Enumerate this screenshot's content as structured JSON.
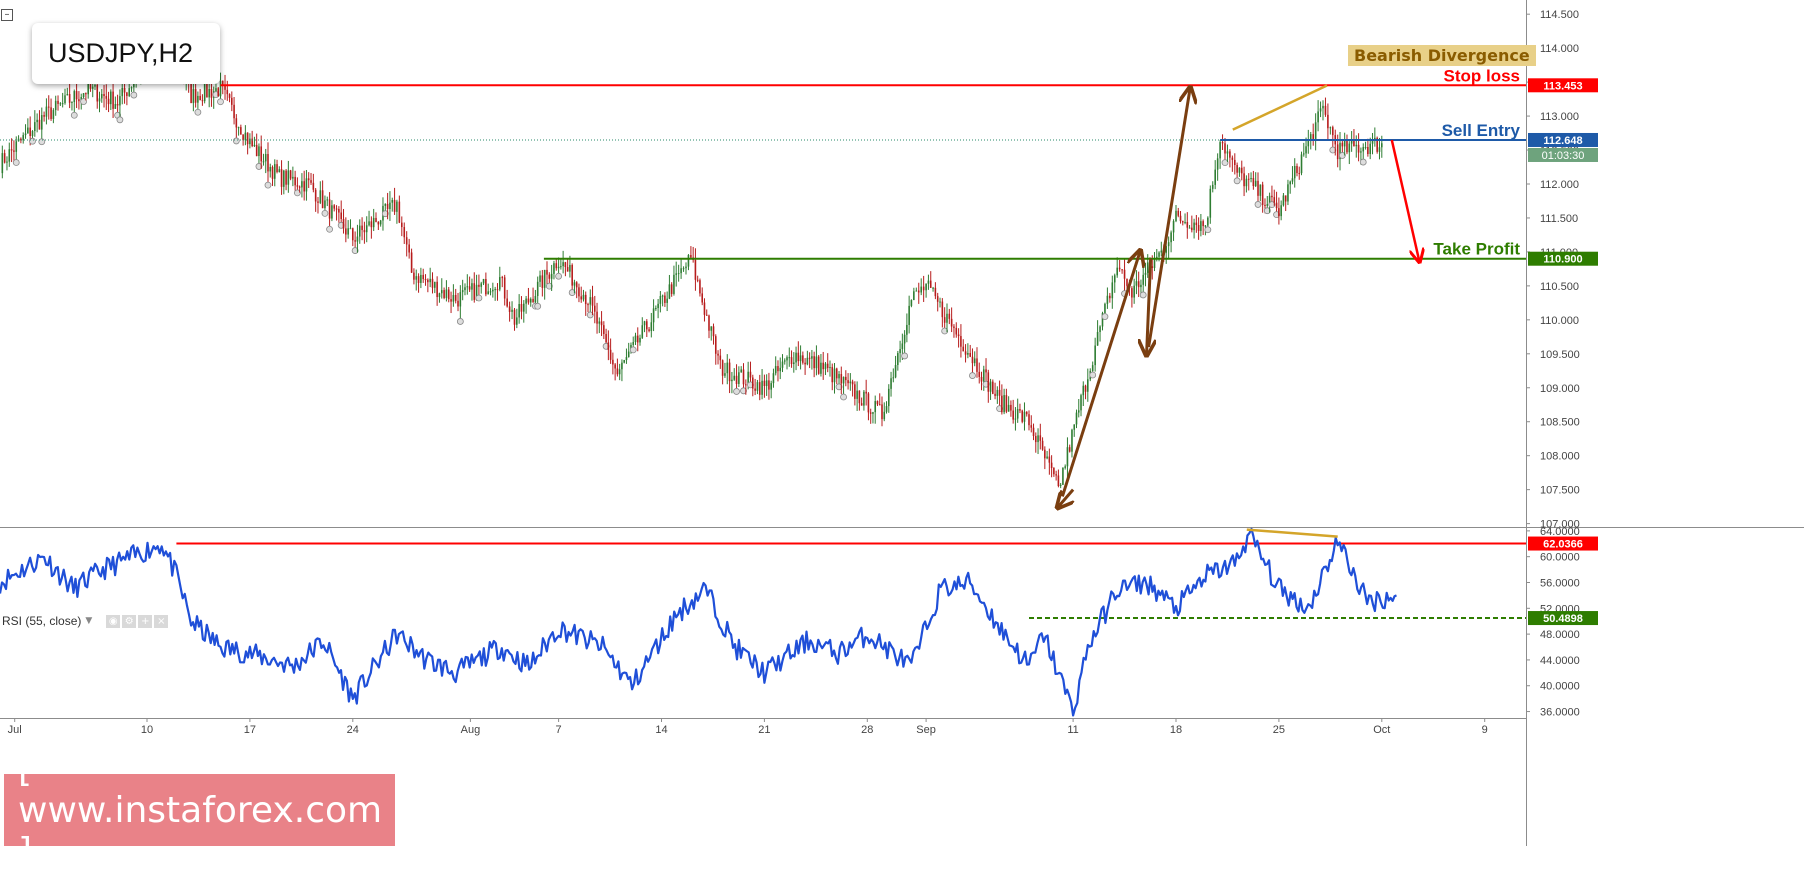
{
  "symbol": "USDJPY,H2",
  "indicator_legend": "RSI (55, close)",
  "annotations": {
    "bearish_divergence": "Bearish Divergence",
    "stop_loss": "Stop loss",
    "sell_entry": "Sell Entry",
    "take_profit": "Take Profit",
    "countdown": "01:03:30"
  },
  "watermark": "[ www.instaforex.com ]",
  "colors": {
    "stop_loss": "#ff0000",
    "sell_entry": "#1e5aa8",
    "take_profit": "#2e7d00",
    "rsi_line": "#1f4fd8",
    "arrow_brown": "#7a3e10",
    "divergence_line": "#d4a52a",
    "bull_candle": "#2e7d32",
    "bear_candle": "#b71c1c"
  },
  "chart_data": [
    {
      "type": "candlestick",
      "title": "USDJPY,H2",
      "x_ticks": [
        "Jul",
        "10",
        "17",
        "24",
        "Aug",
        "7",
        "14",
        "21",
        "28",
        "Sep",
        "11",
        "18",
        "25",
        "Oct",
        "9"
      ],
      "y_ticks": [
        "107.000",
        "107.500",
        "108.000",
        "108.500",
        "109.000",
        "109.500",
        "110.000",
        "110.500",
        "111.000",
        "111.500",
        "112.000",
        "112.500",
        "113.000",
        "113.500",
        "114.000",
        "114.500"
      ],
      "ylim": [
        106.95,
        114.65
      ],
      "levels": [
        {
          "name": "Stop loss",
          "value": 113.453,
          "label": "113.453"
        },
        {
          "name": "Sell Entry",
          "value": 112.648,
          "label": "112.648"
        },
        {
          "name": "Take Profit",
          "value": 110.9,
          "label": "110.900"
        }
      ],
      "price_path": [
        {
          "x": "Jun 30",
          "y": 112.3
        },
        {
          "x": "Jul 3",
          "y": 113.0
        },
        {
          "x": "Jul 6",
          "y": 113.4
        },
        {
          "x": "Jul 8",
          "y": 113.2
        },
        {
          "x": "Jul 11",
          "y": 114.1
        },
        {
          "x": "Jul 12",
          "y": 113.8
        },
        {
          "x": "Jul 13",
          "y": 113.3
        },
        {
          "x": "Jul 15",
          "y": 113.4
        },
        {
          "x": "Jul 17",
          "y": 112.6
        },
        {
          "x": "Jul 19",
          "y": 112.1
        },
        {
          "x": "Jul 21",
          "y": 112.0
        },
        {
          "x": "Jul 24",
          "y": 111.2
        },
        {
          "x": "Jul 27",
          "y": 111.7
        },
        {
          "x": "Jul 28",
          "y": 110.7
        },
        {
          "x": "Jul 31",
          "y": 110.3
        },
        {
          "x": "Aug 3",
          "y": 110.6
        },
        {
          "x": "Aug 4",
          "y": 110.0
        },
        {
          "x": "Aug 7",
          "y": 110.9
        },
        {
          "x": "Aug 9",
          "y": 110.3
        },
        {
          "x": "Aug 11",
          "y": 109.2
        },
        {
          "x": "Aug 15",
          "y": 110.6
        },
        {
          "x": "Aug 16",
          "y": 110.9
        },
        {
          "x": "Aug 18",
          "y": 109.3
        },
        {
          "x": "Aug 21",
          "y": 109.0
        },
        {
          "x": "Aug 23",
          "y": 109.5
        },
        {
          "x": "Aug 25",
          "y": 109.3
        },
        {
          "x": "Aug 29",
          "y": 108.6
        },
        {
          "x": "Aug 31",
          "y": 110.3
        },
        {
          "x": "Sep 1",
          "y": 110.5
        },
        {
          "x": "Sep 4",
          "y": 109.5
        },
        {
          "x": "Sep 6",
          "y": 108.8
        },
        {
          "x": "Sep 8",
          "y": 108.5
        },
        {
          "x": "Sep 10",
          "y": 107.5
        },
        {
          "x": "Sep 12",
          "y": 109.2
        },
        {
          "x": "Sep 13",
          "y": 110.0
        },
        {
          "x": "Sep 14",
          "y": 110.8
        },
        {
          "x": "Sep 15",
          "y": 110.4
        },
        {
          "x": "Sep 17",
          "y": 111.0
        },
        {
          "x": "Sep 18",
          "y": 111.5
        },
        {
          "x": "Sep 20",
          "y": 111.4
        },
        {
          "x": "Sep 21",
          "y": 112.7
        },
        {
          "x": "Sep 22",
          "y": 112.2
        },
        {
          "x": "Sep 25",
          "y": 111.6
        },
        {
          "x": "Sep 27",
          "y": 112.6
        },
        {
          "x": "Sep 28",
          "y": 113.1
        },
        {
          "x": "Sep 29",
          "y": 112.5
        },
        {
          "x": "Oct 2",
          "y": 112.6
        }
      ],
      "projection": {
        "from_value": 112.648,
        "to_value": 110.9
      }
    },
    {
      "type": "line",
      "title": "RSI (55, close)",
      "y_ticks": [
        "36.0000",
        "40.0000",
        "44.0000",
        "48.0000",
        "52.0000",
        "56.0000",
        "60.0000",
        "64.0000"
      ],
      "ylim": [
        35.0,
        64.6
      ],
      "levels": [
        {
          "value": 62.0366,
          "label": "62.0366",
          "style": "solid"
        },
        {
          "value": 50.4898,
          "label": "50.4898",
          "style": "dashed"
        }
      ],
      "series": [
        {
          "values": [
            {
              "x": "Jun 30",
              "y": 56.0
            },
            {
              "x": "Jul 3",
              "y": 60.0
            },
            {
              "x": "Jul 5",
              "y": 55.0
            },
            {
              "x": "Jul 7",
              "y": 58.0
            },
            {
              "x": "Jul 11",
              "y": 62.0
            },
            {
              "x": "Jul 12",
              "y": 57.0
            },
            {
              "x": "Jul 13",
              "y": 50.0
            },
            {
              "x": "Jul 15",
              "y": 46.0
            },
            {
              "x": "Jul 17",
              "y": 45.0
            },
            {
              "x": "Jul 20",
              "y": 43.0
            },
            {
              "x": "Jul 22",
              "y": 47.0
            },
            {
              "x": "Jul 24",
              "y": 38.0
            },
            {
              "x": "Jul 27",
              "y": 48.0
            },
            {
              "x": "Jul 29",
              "y": 44.0
            },
            {
              "x": "Jul 31",
              "y": 42.0
            },
            {
              "x": "Aug 3",
              "y": 46.0
            },
            {
              "x": "Aug 5",
              "y": 43.0
            },
            {
              "x": "Aug 7",
              "y": 49.0
            },
            {
              "x": "Aug 10",
              "y": 46.0
            },
            {
              "x": "Aug 12",
              "y": 40.0
            },
            {
              "x": "Aug 15",
              "y": 51.0
            },
            {
              "x": "Aug 17",
              "y": 55.0
            },
            {
              "x": "Aug 19",
              "y": 46.0
            },
            {
              "x": "Aug 21",
              "y": 42.0
            },
            {
              "x": "Aug 24",
              "y": 47.0
            },
            {
              "x": "Aug 26",
              "y": 45.0
            },
            {
              "x": "Aug 28",
              "y": 48.0
            },
            {
              "x": "Aug 31",
              "y": 43.0
            },
            {
              "x": "Sep 2",
              "y": 55.0
            },
            {
              "x": "Sep 4",
              "y": 56.0
            },
            {
              "x": "Sep 6",
              "y": 49.0
            },
            {
              "x": "Sep 8",
              "y": 43.0
            },
            {
              "x": "Sep 9",
              "y": 48.0
            },
            {
              "x": "Sep 11",
              "y": 36.0
            },
            {
              "x": "Sep 12",
              "y": 46.0
            },
            {
              "x": "Sep 14",
              "y": 55.0
            },
            {
              "x": "Sep 16",
              "y": 56.0
            },
            {
              "x": "Sep 18",
              "y": 52.0
            },
            {
              "x": "Sep 20",
              "y": 57.0
            },
            {
              "x": "Sep 22",
              "y": 59.0
            },
            {
              "x": "Sep 23",
              "y": 63.5
            },
            {
              "x": "Sep 25",
              "y": 55.0
            },
            {
              "x": "Sep 27",
              "y": 52.0
            },
            {
              "x": "Sep 29",
              "y": 62.5
            },
            {
              "x": "Oct 1",
              "y": 53.0
            },
            {
              "x": "Oct 3",
              "y": 54.0
            }
          ]
        }
      ]
    }
  ]
}
